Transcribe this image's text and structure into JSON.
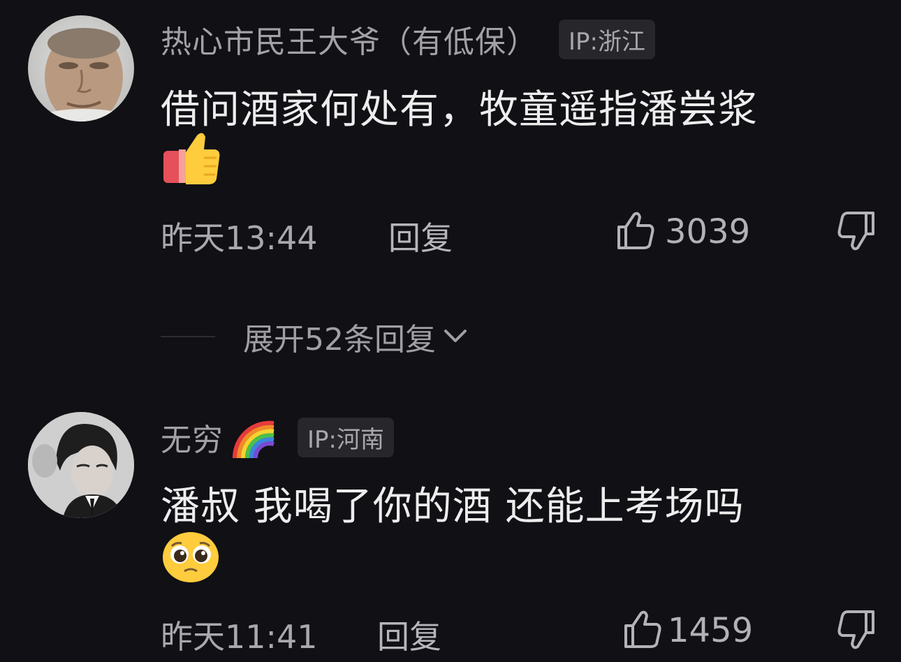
{
  "comments": [
    {
      "username": "热心市民王大爷（有低保）",
      "ip": "IP:浙江",
      "text": "借问酒家何处有，牧童遥指潘尝浆",
      "emoji": "thumbs-up-emoji",
      "time": "昨天13:44",
      "reply_label": "回复",
      "likes": "3039",
      "avatar": "elderly-man-avatar"
    },
    {
      "username": "无穷",
      "username_emoji": "rainbow-emoji",
      "ip": "IP:河南",
      "text": "潘叔 我喝了你的酒  还能上考场吗",
      "emoji": "pleading-face-emoji",
      "time": "昨天11:41",
      "reply_label": "回复",
      "likes": "1459",
      "avatar": "young-man-avatar"
    }
  ],
  "expand_replies": {
    "label": "展开52条回复",
    "icon": "chevron-down-icon"
  },
  "colors": {
    "background": "#101015",
    "text_primary": "#ededed",
    "text_secondary": "#a8a8ad",
    "badge_bg": "#26262b"
  }
}
